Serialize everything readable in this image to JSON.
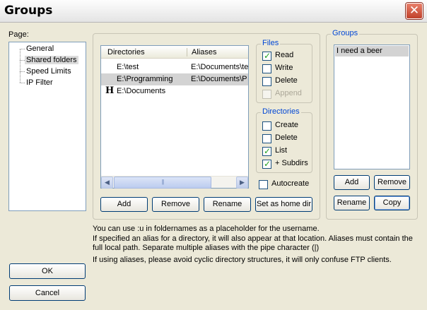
{
  "window": {
    "title": "Groups"
  },
  "page_label": "Page:",
  "pages": [
    "General",
    "Shared folders",
    "Speed Limits",
    "IP Filter"
  ],
  "directories": {
    "columns": [
      "Directories",
      "Aliases"
    ],
    "rows": [
      {
        "home": "",
        "directory": "E:\\test",
        "alias": "E:\\Documents\\te"
      },
      {
        "home": "",
        "directory": "E:\\Programming",
        "alias": "E:\\Documents\\P"
      },
      {
        "home": "H",
        "directory": "E:\\Documents",
        "alias": ""
      }
    ],
    "scroll": {
      "left_arrow": "◀",
      "right_arrow": "▶",
      "grip": "|||"
    }
  },
  "files": {
    "title": "Files",
    "options": [
      {
        "label": "Read",
        "checked": true,
        "disabled": false
      },
      {
        "label": "Write",
        "checked": false,
        "disabled": false
      },
      {
        "label": "Delete",
        "checked": false,
        "disabled": false
      },
      {
        "label": "Append",
        "checked": false,
        "disabled": true
      }
    ]
  },
  "dirs_perm": {
    "title": "Directories",
    "options": [
      {
        "label": "Create",
        "checked": false
      },
      {
        "label": "Delete",
        "checked": false
      },
      {
        "label": "List",
        "checked": true
      },
      {
        "label": "+ Subdirs",
        "checked": true
      }
    ]
  },
  "autocreate": {
    "label": "Autocreate",
    "checked": false
  },
  "dir_buttons": {
    "add": "Add",
    "remove": "Remove",
    "rename": "Rename",
    "home": "Set as home dir"
  },
  "groups": {
    "title": "Groups",
    "items": [
      "I need a beer"
    ],
    "buttons": {
      "add": "Add",
      "remove": "Remove",
      "rename": "Rename",
      "copy": "Copy"
    }
  },
  "notes": [
    "You can use :u in foldernames as a placeholder for the username.",
    "If specified an alias for a directory, it will also appear at that location. Aliases must contain the full local path. Separate multiple aliases with the pipe character (|)",
    "If using aliases, please avoid cyclic directory structures, it will only confuse FTP clients."
  ],
  "dialog_buttons": {
    "ok": "OK",
    "cancel": "Cancel"
  },
  "colors": {
    "groupbox_title": "#0046d5",
    "dialog_bg": "#ece9d8",
    "close_button": "#c0402a"
  }
}
